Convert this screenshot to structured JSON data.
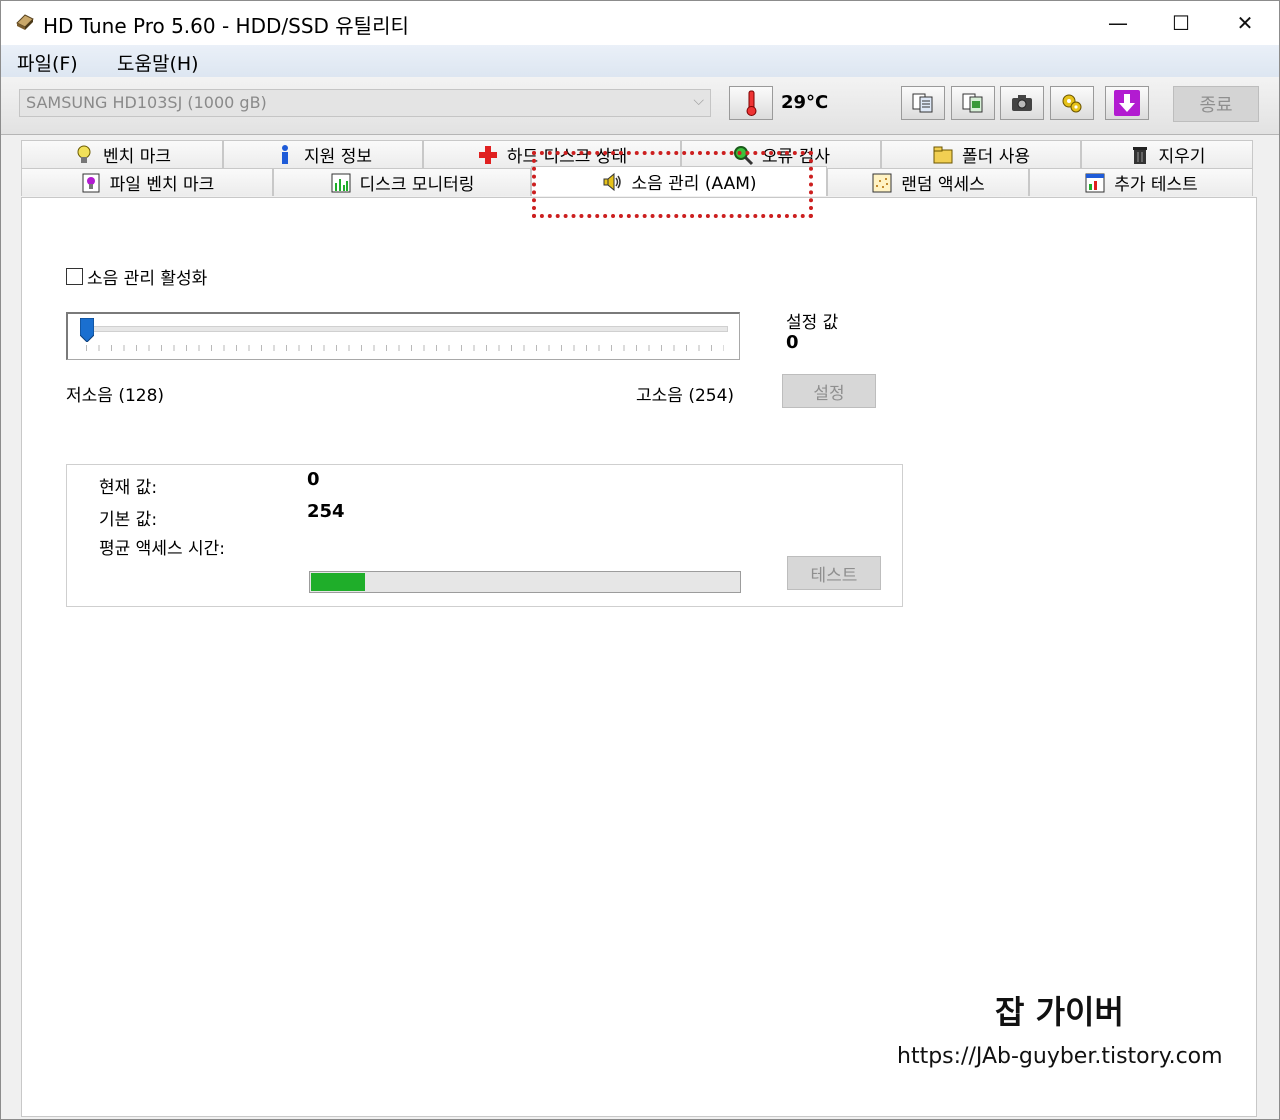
{
  "window": {
    "title": "HD Tune Pro 5.60 - HDD/SSD  유틸리티",
    "minimize_glyph": "—",
    "maximize_glyph": "☐",
    "close_glyph": "✕"
  },
  "menu": {
    "items": [
      "파일(F)",
      "도움말(H)"
    ]
  },
  "toolbar": {
    "drive": "SAMSUNG HD103SJ (1000 gB)",
    "temperature": "29°C",
    "exit_label": "종료",
    "icons": [
      "thermometer-icon",
      "copy-info-icon",
      "copy-screen-icon",
      "camera-icon",
      "options-icon",
      "download-icon"
    ]
  },
  "tabs": {
    "row1": [
      {
        "label": "벤치 마크",
        "icon": "lightbulb-icon"
      },
      {
        "label": "지원 정보",
        "icon": "info-icon"
      },
      {
        "label": "하드 디스크 상태",
        "icon": "health-cross-icon"
      },
      {
        "label": "오류 검사",
        "icon": "magnifier-icon"
      },
      {
        "label": "폴더 사용",
        "icon": "folder-icon"
      },
      {
        "label": "지우기",
        "icon": "trash-icon"
      }
    ],
    "row2": [
      {
        "label": "파일 벤치 마크",
        "icon": "file-bench-icon"
      },
      {
        "label": "디스크 모니터링",
        "icon": "chart-icon"
      },
      {
        "label": "소음 관리 (AAM)",
        "icon": "speaker-icon"
      },
      {
        "label": "랜덤 액세스",
        "icon": "dots-icon"
      },
      {
        "label": "추가 테스트",
        "icon": "extra-test-icon"
      }
    ],
    "active": "소음 관리 (AAM)"
  },
  "aam": {
    "enable_label": "소음 관리 활성화",
    "enabled": false,
    "setting_label": "설정 값",
    "setting_value": "0",
    "low_label": "저소음 (128)",
    "high_label": "고소음 (254)",
    "set_button": "설정",
    "slider_min": 128,
    "slider_max": 254,
    "slider_value": 128,
    "current_label": "현재 값:",
    "current_value": "0",
    "default_label": "기본 값:",
    "default_value": "254",
    "access_time_label": "평균 액세스 시간:",
    "progress_fraction": 0.125,
    "test_button": "테스트"
  },
  "watermark": {
    "title": "잡 가이버",
    "url": "https://JAb-guyber.tistory.com"
  },
  "colors": {
    "highlight": "#cc1f1f",
    "progress": "#1fae2a",
    "slider_thumb": "#1a6fd0"
  }
}
